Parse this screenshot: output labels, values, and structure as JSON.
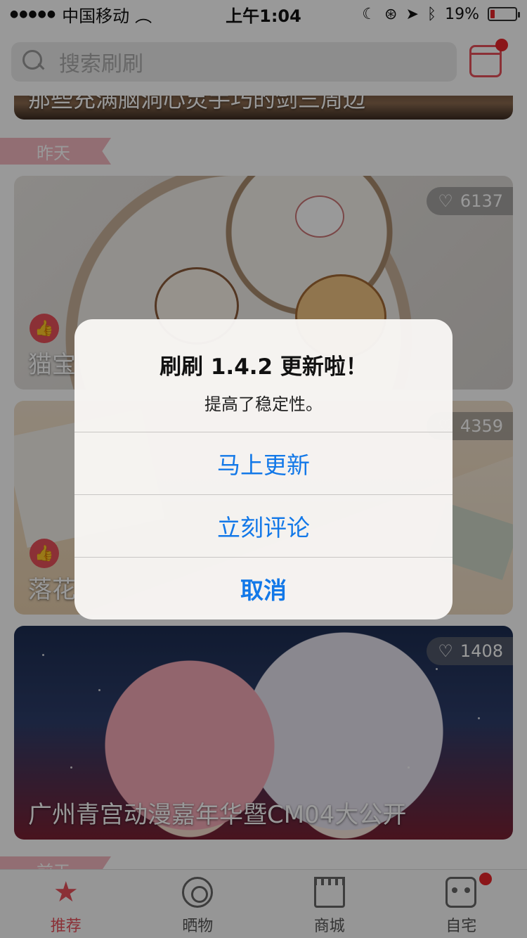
{
  "status_bar": {
    "carrier": "中国移动",
    "time": "上午1:04",
    "battery_percent": "19%",
    "battery_level": 0.19,
    "battery_color": "#e8262a"
  },
  "header": {
    "search_placeholder": "搜索刷刷",
    "checkin_icon": "calendar-check-icon",
    "notification_color": "#e8262a"
  },
  "feed": {
    "top_card_title": "那些充满脑洞心灵手巧的剑三周边",
    "section_yesterday": "昨天",
    "section_next": "前天",
    "cards": [
      {
        "title": "猫宝",
        "likes": "6137"
      },
      {
        "title": "落花",
        "likes": "4359"
      },
      {
        "title": "广州青宫动漫嘉年华暨CM04大公开",
        "likes": "1408"
      }
    ]
  },
  "tabbar": {
    "items": [
      {
        "label": "推荐",
        "icon": "star-icon",
        "active": true
      },
      {
        "label": "晒物",
        "icon": "camera-icon",
        "active": false
      },
      {
        "label": "商城",
        "icon": "shop-icon",
        "active": false
      },
      {
        "label": "自宅",
        "icon": "robot-icon",
        "active": false
      }
    ]
  },
  "alert": {
    "title": "刷刷 1.4.2 更新啦！",
    "message": "提高了稳定性。",
    "buttons": {
      "update": "马上更新",
      "review": "立刻评论",
      "cancel": "取消"
    },
    "button_color": "#1278e8"
  },
  "accent_color": "#e8505b"
}
